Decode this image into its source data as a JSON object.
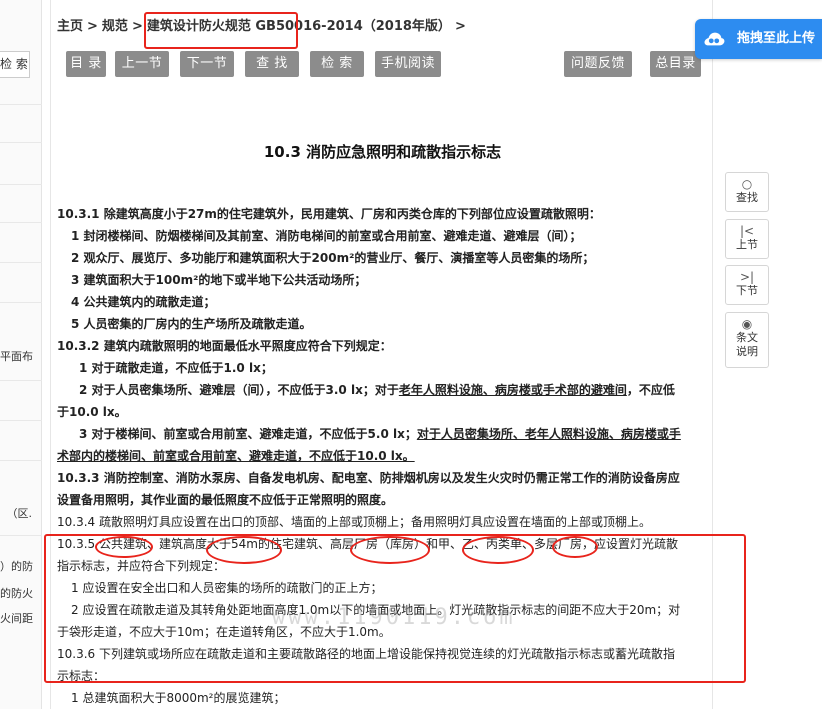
{
  "left_strip": {
    "button_label": "检 索",
    "texts": [
      "平面布",
      "（区.",
      "）的防",
      "的防火",
      "火间距"
    ]
  },
  "breadcrumb": {
    "home": "主页",
    "section": "规范",
    "current": "建筑设计防火规范 GB50016-2014（2018年版）",
    "separator": ">"
  },
  "toolbar": {
    "toc": "目 录",
    "prev": "上一节",
    "next": "下一节",
    "find": "查 找",
    "search": "检 索",
    "mobile": "手机阅读",
    "feedback": "问题反馈",
    "all_toc": "总目录"
  },
  "upload": {
    "label": "拖拽至此上传",
    "icon": "cloud-upload-icon"
  },
  "side_tools": {
    "find": "查找",
    "prev": "上节",
    "next": "下节",
    "explain_1": "条文",
    "explain_2": "说明"
  },
  "document": {
    "title": "10.3 消防应急照明和疏散指示标志",
    "lines": [
      "10.3.1 除建筑高度小于27m的住宅建筑外，民用建筑、厂房和丙类仓库的下列部位应设置疏散照明：",
      "1 封闭楼梯间、防烟楼梯间及其前室、消防电梯间的前室或合用前室、避难走道、避难层（间）；",
      "2 观众厅、展览厅、多功能厅和建筑面积大于200m²的营业厅、餐厅、演播室等人员密集的场所；",
      "3 建筑面积大于100m²的地下或半地下公共活动场所；",
      "4 公共建筑内的疏散走道；",
      "5 人员密集的厂房内的生产场所及疏散走道。",
      "10.3.2 建筑内疏散照明的地面最低水平照度应符合下列规定：",
      "1 对于疏散走道，不应低于1.0 lx；",
      "2 对于人员密集场所、避难层（间），不应低于3.0 lx；对于",
      "老年人照料设施、病房楼或手术部的避难间",
      "，不应低",
      "于10.0 lx。",
      "3 对于楼梯间、前室或合用前室、避难走道，不应低于5.0 lx；",
      "对于人员密集场所、老年人照料设施、病房楼或手",
      "术部内的楼梯间、前室或合用前室、避难走道，不应低于10.0 lx。",
      "10.3.3 消防控制室、消防水泵房、自备发电机房、配电室、防排烟机房以及发生火灾时仍需正常工作的消防设备房应",
      "设置备用照明，其作业面的最低照度不应低于正常照明的照度。",
      "10.3.4 疏散照明灯具应设置在出口的顶部、墙面的上部或顶棚上；备用照明灯具应设置在墙面的上部或顶棚上。",
      "10.3.5 公共建筑、建筑高度大于54m的住宅建筑、高层厂房（库房）和甲、乙、丙类单、多层厂房，应设置灯光疏散",
      "指示标志，并应符合下列规定：",
      "1 应设置在安全出口和人员密集的场所的疏散门的正上方；",
      "2 应设置在疏散走道及其转角处距地面高度1.0m以下的墙面或地面上。灯光疏散指示标志的间距不应大于20m；对",
      "于袋形走道，不应大于10m；在走道转角区，不应大于1.0m。",
      "10.3.6 下列建筑或场所应在疏散走道和主要疏散路径的地面上增设能保持视觉连续的灯光疏散指示标志或蓄光疏散指",
      "示标志：",
      "1 总建筑面积大于8000m²的展览建筑；"
    ]
  },
  "watermark": "www.1190119.com",
  "annotation_color": "#e8241c"
}
